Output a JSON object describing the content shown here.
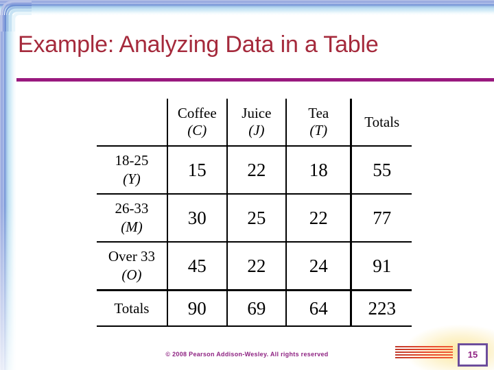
{
  "slide": {
    "title": "Example: Analyzing Data in a Table",
    "accent_rule_color": "#99197e",
    "title_color": "#a52a3c",
    "slide_number": "15",
    "copyright": "© 2008 Pearson Addison-Wesley. All rights reserved"
  },
  "table": {
    "corner_header": "",
    "column_headers": [
      {
        "name": "Coffee",
        "symbol": "(C)"
      },
      {
        "name": "Juice",
        "symbol": "(J)"
      },
      {
        "name": "Tea",
        "symbol": "(T)"
      },
      {
        "name": "Totals",
        "symbol": ""
      }
    ],
    "rows": [
      {
        "label": "18-25",
        "symbol": "(Y)",
        "values": [
          "15",
          "22",
          "18",
          "55"
        ]
      },
      {
        "label": "26-33",
        "symbol": "(M)",
        "values": [
          "30",
          "25",
          "22",
          "77"
        ]
      },
      {
        "label": "Over 33",
        "symbol": "(O)",
        "values": [
          "45",
          "22",
          "24",
          "91"
        ]
      }
    ],
    "totals_row": {
      "label": "Totals",
      "symbol": "",
      "values": [
        "90",
        "69",
        "64",
        "223"
      ]
    }
  },
  "chart_data": {
    "type": "table",
    "title": "Example: Analyzing Data in a Table",
    "categories": [
      "Coffee (C)",
      "Juice (J)",
      "Tea (T)"
    ],
    "row_categories": [
      "18-25 (Y)",
      "26-33 (M)",
      "Over 33 (O)"
    ],
    "series": [
      {
        "name": "18-25 (Y)",
        "values": [
          15,
          22,
          18
        ],
        "total": 55
      },
      {
        "name": "26-33 (M)",
        "values": [
          30,
          25,
          22
        ],
        "total": 77
      },
      {
        "name": "Over 33 (O)",
        "values": [
          45,
          22,
          24
        ],
        "total": 91
      }
    ],
    "column_totals": [
      90,
      69,
      64
    ],
    "grand_total": 223
  }
}
